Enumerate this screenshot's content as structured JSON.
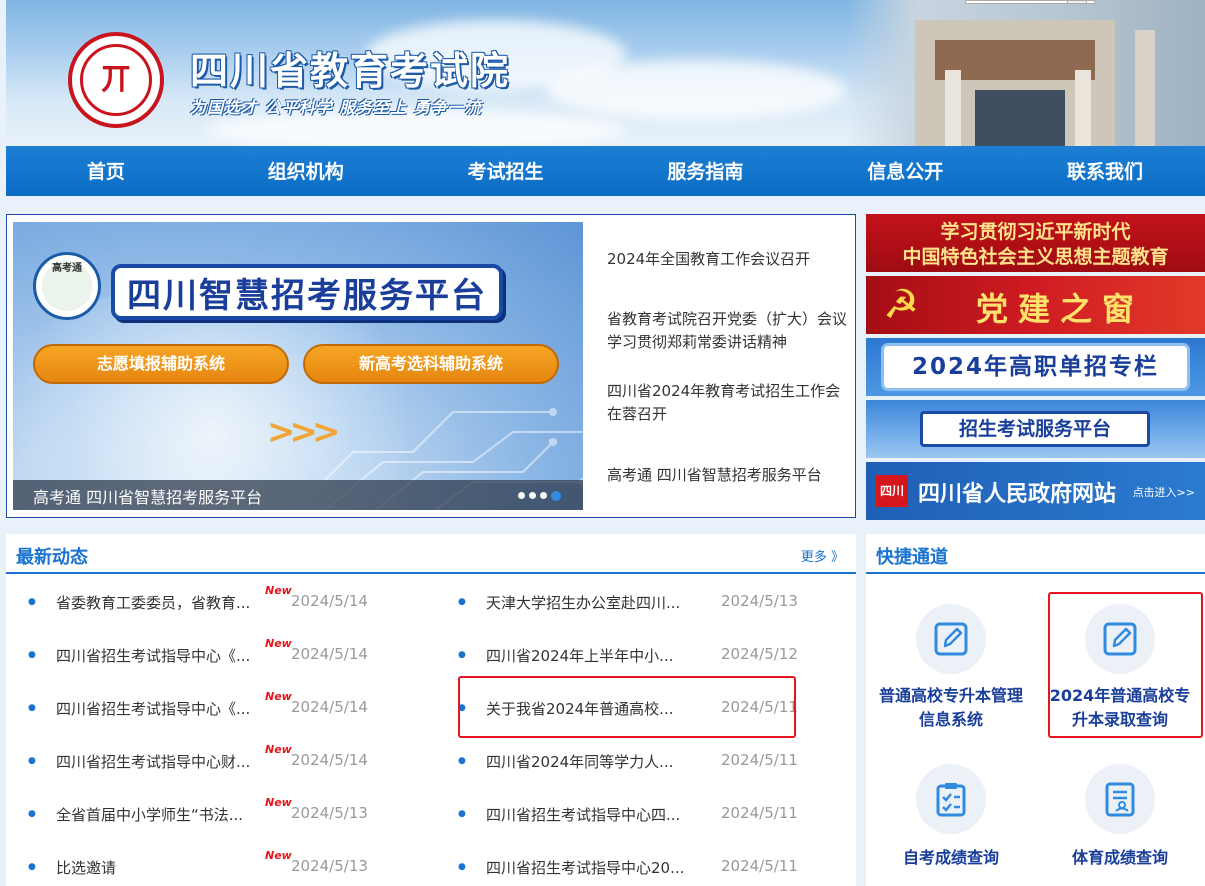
{
  "header": {
    "site_title": "四川省教育考试院",
    "slogan": "为国选才  公平科学  服务至上  勇争一流",
    "logo_glyph": "丌"
  },
  "nav": {
    "items": [
      "首页",
      "组织机构",
      "考试招生",
      "服务指南",
      "信息公开",
      "联系我们"
    ]
  },
  "slider": {
    "logo_text": "高考通",
    "title": "四川智慧招考服务平台",
    "button_1": "志愿填报辅助系统",
    "button_2": "新高考选科辅助系统",
    "arrows": ">>>",
    "caption": "高考通 四川省智慧招考服务平台",
    "dot_count": 4,
    "active_dot": 4
  },
  "headlines": [
    "2024年全国教育工作会议召开",
    "省教育考试院召开党委（扩大）会议学习贯彻郑莉常委讲话精神",
    "四川省2024年教育考试招生工作会在蓉召开",
    "高考通 四川省智慧招考服务平台"
  ],
  "banners": {
    "banner_1_line_1": "学习贯彻习近平新时代",
    "banner_1_line_2": "中国特色社会主义思想主题教育",
    "banner_2": "党建之窗",
    "banner_3": "2024年高职单招专栏",
    "banner_4": "招生考试服务平台",
    "banner_5_seal": "四川",
    "banner_5": "四川省人民政府网站",
    "banner_5_enter": "点击进入>>"
  },
  "news": {
    "title": "最新动态",
    "more": "更多 》",
    "new_badge": "New",
    "left": [
      {
        "title": "省委教育工委委员，省教育...",
        "date": "2024/5/14",
        "is_new": true
      },
      {
        "title": "四川省招生考试指导中心《...",
        "date": "2024/5/14",
        "is_new": true
      },
      {
        "title": "四川省招生考试指导中心《...",
        "date": "2024/5/14",
        "is_new": true
      },
      {
        "title": "四川省招生考试指导中心财...",
        "date": "2024/5/14",
        "is_new": true
      },
      {
        "title": "全省首届中小学师生“书法...",
        "date": "2024/5/13",
        "is_new": true
      },
      {
        "title": "比选邀请",
        "date": "2024/5/13",
        "is_new": true
      }
    ],
    "right": [
      {
        "title": "天津大学招生办公室赴四川...",
        "date": "2024/5/13"
      },
      {
        "title": "四川省2024年上半年中小...",
        "date": "2024/5/12"
      },
      {
        "title": "关于我省2024年普通高校...",
        "date": "2024/5/11"
      },
      {
        "title": "四川省2024年同等学力人...",
        "date": "2024/5/11"
      },
      {
        "title": "四川省招生考试指导中心四...",
        "date": "2024/5/11"
      },
      {
        "title": "四川省招生考试指导中心20...",
        "date": "2024/5/11"
      }
    ]
  },
  "quick": {
    "title": "快捷通道",
    "items": [
      {
        "label_1": "普通高校专升本管理",
        "label_2": "信息系统",
        "icon": "edit-icon"
      },
      {
        "label_1": "2024年普通高校专",
        "label_2": "升本录取查询",
        "icon": "edit-icon"
      },
      {
        "label_1": "自考成绩查询",
        "label_2": "",
        "icon": "clipboard-check-icon"
      },
      {
        "label_1": "体育成绩查询",
        "label_2": "",
        "icon": "document-list-icon"
      }
    ]
  },
  "colors": {
    "primary_blue": "#1a73d0",
    "nav_blue": "#0b6cc4",
    "highlight_red": "#e5161d",
    "button_orange": "#f39c1a"
  }
}
